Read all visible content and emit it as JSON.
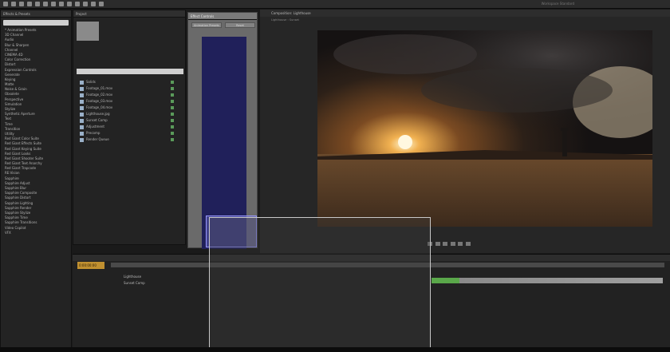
{
  "app": {
    "workspace_label": "Workspace  Standard"
  },
  "colors": {
    "accent": "#c09030",
    "bg": "#1a1a1a",
    "drag_blue": "#9898ff",
    "green_bar": "#5aa84a"
  },
  "effects_panel": {
    "tab": "Effects & Presets",
    "items": [
      "* Animation Presets",
      "3D Channel",
      "Audio",
      "Blur & Sharpen",
      "Channel",
      "CINEMA 4D",
      "Color Correction",
      "Distort",
      "Expression Controls",
      "Generate",
      "Keying",
      "Matte",
      "Noise & Grain",
      "Obsolete",
      "Perspective",
      "Simulation",
      "Stylize",
      "Synthetic Aperture",
      "Text",
      "Time",
      "Transition",
      "Utility",
      "Red Giant Color Suite",
      "Red Giant Effects Suite",
      "Red Giant Keying Suite",
      "Red Giant Looks",
      "Red Giant Shooter Suite",
      "Red Giant Text Anarchy",
      "Red Giant Trapcode",
      "RE:Vision",
      "Sapphire",
      "Sapphire Adjust",
      "Sapphire Blur",
      "Sapphire Composite",
      "Sapphire Distort",
      "Sapphire Lighting",
      "Sapphire Render",
      "Sapphire Stylize",
      "Sapphire Time",
      "Sapphire Transitions",
      "Video Copilot",
      "VFX"
    ]
  },
  "project_panel": {
    "tab": "Project",
    "rows": [
      "Solids",
      "Footage_01.mov",
      "Footage_02.mov",
      "Footage_03.mov",
      "Footage_04.mov",
      "Lighthouse.jpg",
      "Sunset Comp",
      "Adjustment",
      "Precomp",
      "Render Queue"
    ]
  },
  "effect_controls": {
    "tab": "Effect Controls",
    "btn1": "Animation Presets",
    "btn2": "Reset"
  },
  "comp_panel": {
    "tab": "Composition: Lighthouse",
    "crumb": "Lighthouse  ‹  Sunset"
  },
  "timeline": {
    "timecode": "0:00:00:00",
    "layers": [
      "Lighthouse",
      "Sunset Comp"
    ]
  },
  "icons": [
    "selection-tool-icon",
    "hand-tool-icon",
    "zoom-tool-icon",
    "rotate-tool-icon",
    "camera-tool-icon",
    "pan-tool-icon",
    "mask-tool-icon",
    "pen-tool-icon",
    "text-tool-icon",
    "brush-tool-icon",
    "stamp-tool-icon",
    "eraser-tool-icon",
    "puppet-tool-icon"
  ]
}
